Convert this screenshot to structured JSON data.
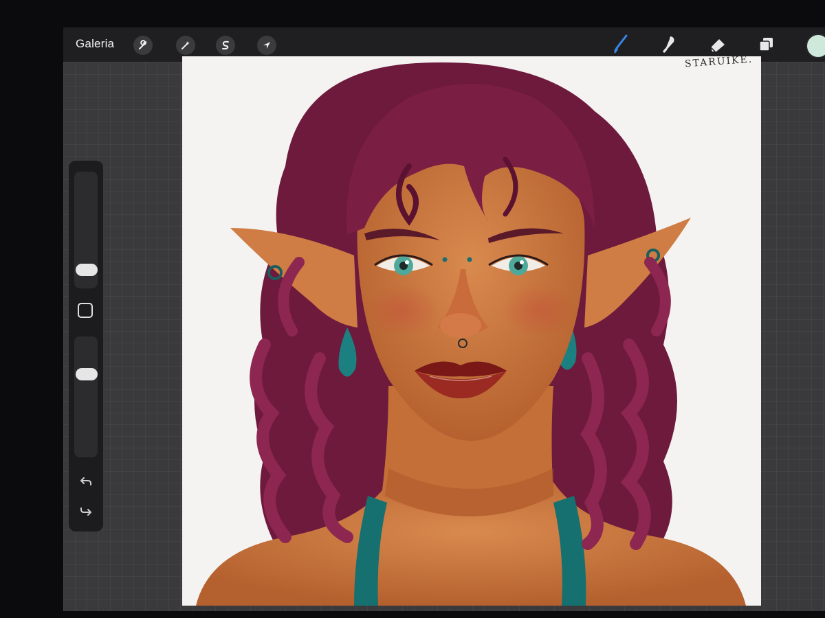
{
  "toolbar": {
    "gallery_label": "Galeria",
    "left_tools": [
      {
        "name": "actions",
        "icon": "wrench-icon"
      },
      {
        "name": "adjustments",
        "icon": "magic-wand-icon"
      },
      {
        "name": "selection",
        "icon": "selection-s-icon"
      },
      {
        "name": "transform",
        "icon": "arrow-cursor-icon"
      }
    ],
    "right_tools": [
      {
        "name": "brush",
        "icon": "brush-icon",
        "active": true
      },
      {
        "name": "smudge",
        "icon": "smudge-finger-icon"
      },
      {
        "name": "eraser",
        "icon": "eraser-icon"
      },
      {
        "name": "layers",
        "icon": "layers-icon"
      }
    ],
    "current_color": "#cfe8dc"
  },
  "sidebar": {
    "brush_size_icon": "slider-thumb",
    "opacity_icon": "slider-thumb",
    "modify_icon": "square-outline-icon",
    "undo_icon": "undo-arrow-icon",
    "redo_icon": "redo-arrow-icon"
  },
  "canvas": {
    "signature": "STARUIKE.",
    "palette": {
      "background": "#f4f3f1",
      "hair": "#7b1e44",
      "skin": "#c9773f",
      "jewelry": "#1c7f80",
      "lips": "#8a1e1e",
      "eyes": "#4fa99a"
    }
  },
  "accent_color": "#3a86e8"
}
